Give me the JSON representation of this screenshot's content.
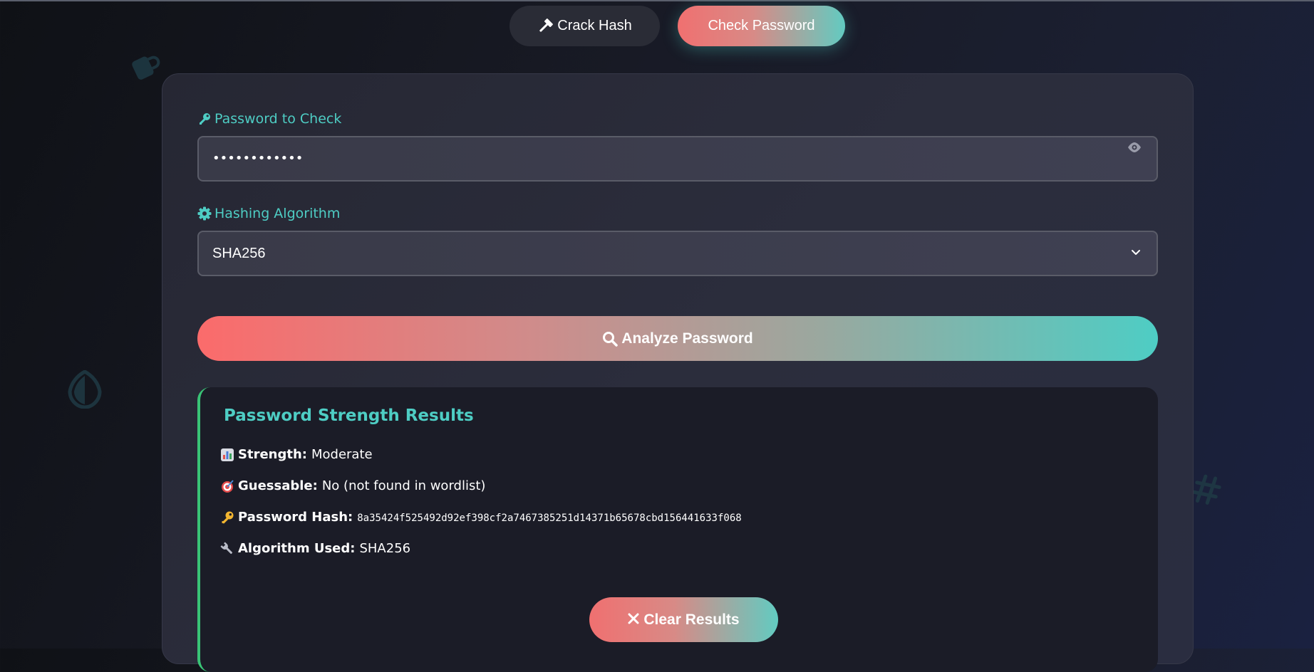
{
  "tabs": [
    {
      "label": "Crack Hash",
      "icon": "hammer-icon",
      "active": false
    },
    {
      "label": "Check Password",
      "active": true
    }
  ],
  "form": {
    "password_label": "Password to Check",
    "password_value": "••••••••••••",
    "algorithm_label": "Hashing Algorithm",
    "algorithm_value": "SHA256",
    "analyze_label": "Analyze Password"
  },
  "results": {
    "title": "Password Strength Results",
    "rows": [
      {
        "emoji": "bar-chart-icon",
        "label": "Strength:",
        "value": "Moderate"
      },
      {
        "emoji": "target-icon",
        "label": "Guessable:",
        "value": "No (not found in wordlist)"
      },
      {
        "emoji": "key-icon",
        "label": "Password Hash:",
        "value": "8a35424f525492d92ef398cf2a7467385251d14371b65678cbd156441633f068"
      },
      {
        "emoji": "wrench-icon",
        "label": "Algorithm Used:",
        "value": "SHA256"
      }
    ],
    "clear_label": "Clear Results"
  },
  "colors": {
    "accent_teal": "#4ecdc4",
    "accent_coral": "#ff6b6b",
    "success_green": "#39c476",
    "card_bg": "#2a2c3a"
  }
}
